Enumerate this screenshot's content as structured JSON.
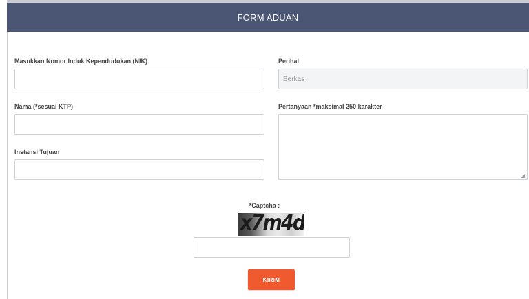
{
  "form": {
    "title": "FORM ADUAN",
    "nik": {
      "label": "Masukkan Nomor Induk Kependudukan (NIK)",
      "value": ""
    },
    "nama": {
      "label": "Nama (*sesuai KTP)",
      "value": ""
    },
    "instansi": {
      "label": "Instansi Tujuan",
      "value": ""
    },
    "perihal": {
      "label": "Perihal",
      "value": "Berkas"
    },
    "pertanyaan": {
      "label": "Pertanyaan *maksimal 250 karakter",
      "value": ""
    },
    "captcha": {
      "label": "*Captcha :",
      "image_text": "x7m4d",
      "value": ""
    },
    "submit_label": "KIRIM"
  },
  "colors": {
    "header_bg": "#4b5675",
    "submit_bg": "#ef5a2f"
  },
  "icons": {
    "textarea_resize": "resize-handle-icon"
  }
}
